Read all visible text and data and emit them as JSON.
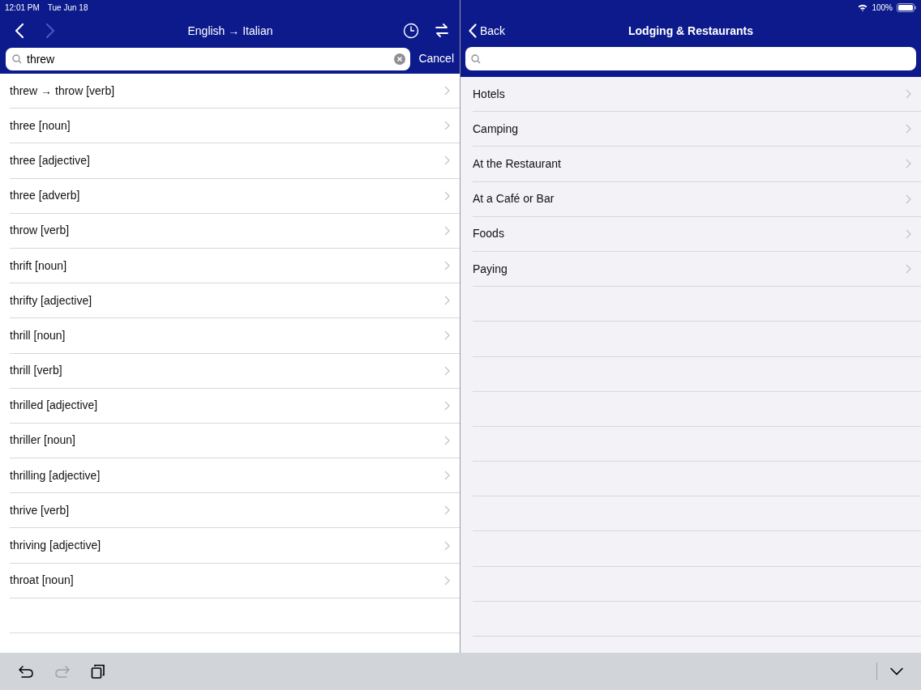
{
  "status_bar": {
    "time": "12:01 PM",
    "date": "Tue Jun 18",
    "battery": "100%"
  },
  "left": {
    "nav": {
      "back_disabled": false,
      "forward_disabled": true,
      "title": "English → Italian"
    },
    "search": {
      "value": "threw",
      "cancel": "Cancel"
    },
    "results": [
      {
        "label": "threw → throw [verb]"
      },
      {
        "label": "three [noun]"
      },
      {
        "label": "three [adjective]"
      },
      {
        "label": "three [adverb]"
      },
      {
        "label": "throw [verb]"
      },
      {
        "label": "thrift [noun]"
      },
      {
        "label": "thrifty [adjective]"
      },
      {
        "label": "thrill [noun]"
      },
      {
        "label": "thrill [verb]"
      },
      {
        "label": "thrilled [adjective]"
      },
      {
        "label": "thriller [noun]"
      },
      {
        "label": "thrilling [adjective]"
      },
      {
        "label": "thrive [verb]"
      },
      {
        "label": "thriving [adjective]"
      },
      {
        "label": "throat [noun]"
      }
    ]
  },
  "right": {
    "back": "Back",
    "title": "Lodging & Restaurants",
    "items": [
      {
        "label": "Hotels"
      },
      {
        "label": "Camping"
      },
      {
        "label": "At the Restaurant"
      },
      {
        "label": "At a Café or Bar"
      },
      {
        "label": "Foods"
      },
      {
        "label": "Paying"
      }
    ]
  },
  "keyboard_toolbar": {
    "undo_disabled": false,
    "redo_disabled": true
  }
}
